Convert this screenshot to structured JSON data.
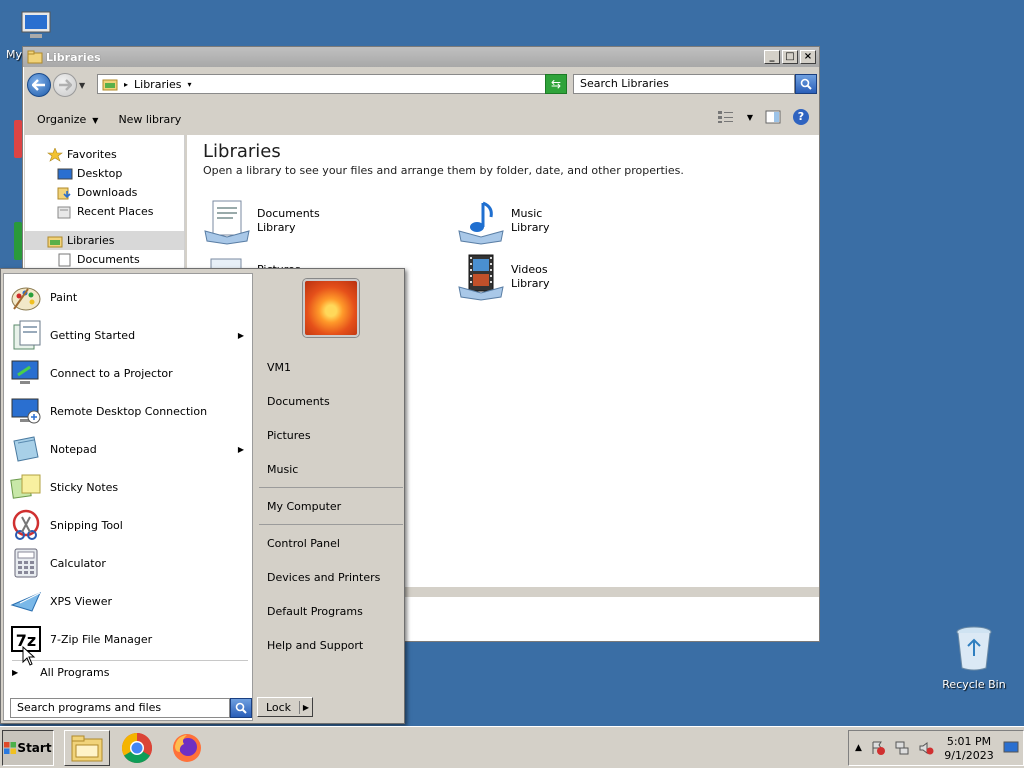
{
  "desktop": {
    "icons": [
      {
        "label": "My",
        "name": "my-computer"
      },
      {
        "label": "Recycle Bin",
        "name": "recycle-bin"
      }
    ]
  },
  "window": {
    "title": "Libraries",
    "address_crumb": "Libraries",
    "search_placeholder": "Search Libraries",
    "toolbar": {
      "organize": "Organize",
      "new_library": "New library"
    }
  },
  "navpane": {
    "items": [
      {
        "label": "Favorites",
        "icon": "star-icon"
      },
      {
        "label": "Desktop",
        "icon": "desktop-icon"
      },
      {
        "label": "Downloads",
        "icon": "downloads-folder-icon"
      },
      {
        "label": "Recent Places",
        "icon": "recent-places-icon"
      },
      {
        "label": "Libraries",
        "icon": "libraries-icon"
      },
      {
        "label": "Documents",
        "icon": "documents-icon"
      }
    ]
  },
  "content": {
    "heading": "Libraries",
    "description": "Open a library to see your files and arrange them by folder, date, and other properties.",
    "libraries": [
      {
        "name": "Documents",
        "type": "Library",
        "icon": "documents-library-icon"
      },
      {
        "name": "Music",
        "type": "Library",
        "icon": "music-library-icon"
      },
      {
        "name": "Pictures",
        "type": "Library",
        "icon": "pictures-library-icon"
      },
      {
        "name": "Videos",
        "type": "Library",
        "icon": "videos-library-icon"
      }
    ]
  },
  "startmenu": {
    "programs": [
      {
        "label": "Paint",
        "icon": "paint-icon",
        "submenu": false
      },
      {
        "label": "Getting Started",
        "icon": "getting-started-icon",
        "submenu": true
      },
      {
        "label": "Connect to a Projector",
        "icon": "projector-icon",
        "submenu": false
      },
      {
        "label": "Remote Desktop Connection",
        "icon": "remote-desktop-icon",
        "submenu": false
      },
      {
        "label": "Notepad",
        "icon": "notepad-icon",
        "submenu": true
      },
      {
        "label": "Sticky Notes",
        "icon": "sticky-notes-icon",
        "submenu": false
      },
      {
        "label": "Snipping Tool",
        "icon": "snipping-tool-icon",
        "submenu": false
      },
      {
        "label": "Calculator",
        "icon": "calculator-icon",
        "submenu": false
      },
      {
        "label": "XPS Viewer",
        "icon": "xps-viewer-icon",
        "submenu": false
      },
      {
        "label": "7-Zip File Manager",
        "icon": "seven-zip-icon",
        "submenu": false
      }
    ],
    "all_programs": "All Programs",
    "search_placeholder": "Search programs and files",
    "right": {
      "user": "VM1",
      "documents": "Documents",
      "pictures": "Pictures",
      "music": "Music",
      "my_computer": "My Computer",
      "control_panel": "Control Panel",
      "devices_printers": "Devices and Printers",
      "default_programs": "Default Programs",
      "help_support": "Help and Support"
    },
    "lock": "Lock"
  },
  "taskbar": {
    "start": "Start",
    "time": "5:01 PM",
    "date": "9/1/2023"
  },
  "colors": {
    "desktop": "#3a6ea5",
    "accent": "#2a5eb8"
  }
}
